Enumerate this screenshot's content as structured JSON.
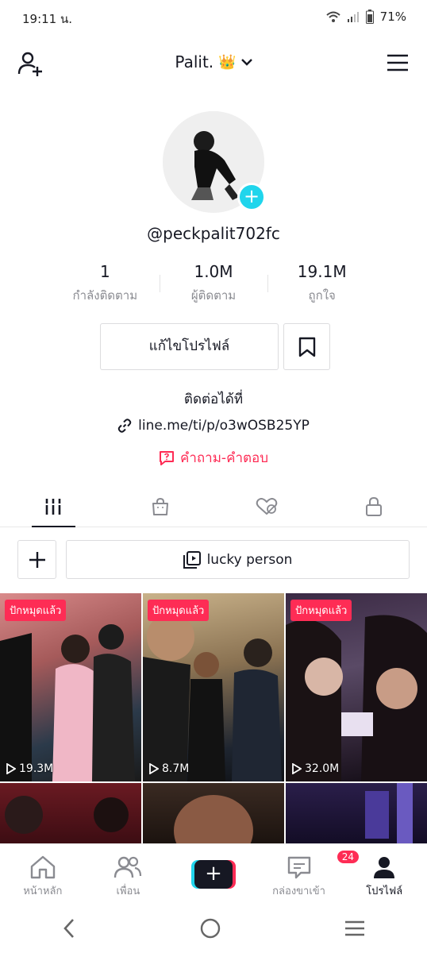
{
  "status_bar": {
    "time": "19:11 น.",
    "battery": "71%"
  },
  "header": {
    "username": "Palit.",
    "crown": "👑"
  },
  "profile": {
    "handle": "@peckpalit702fc",
    "stats": [
      {
        "value": "1",
        "label": "กำลังติดตาม"
      },
      {
        "value": "1.0M",
        "label": "ผู้ติดตาม"
      },
      {
        "value": "19.1M",
        "label": "ถูกใจ"
      }
    ],
    "edit_label": "แก้ไขโปรไฟล์",
    "contact_label": "ติดต่อได้ที่",
    "link": "line.me/ti/p/o3wOSB25YP",
    "qa_label": "คำถาม-คำตอบ"
  },
  "playlist": {
    "name": "lucky person"
  },
  "videos": [
    {
      "pinned": "ปักหมุดแล้ว",
      "views": "19.3M"
    },
    {
      "pinned": "ปักหมุดแล้ว",
      "views": "8.7M"
    },
    {
      "pinned": "ปักหมุดแล้ว",
      "views": "32.0M"
    }
  ],
  "bottom_nav": {
    "home": "หน้าหลัก",
    "friends": "เพื่อน",
    "inbox": "กล่องขาเข้า",
    "inbox_badge": "24",
    "profile": "โปรไฟล์"
  },
  "colors": {
    "accent": "#fe2c55",
    "cyan": "#20d5ec",
    "text": "#161823",
    "muted": "#8a8b91"
  }
}
